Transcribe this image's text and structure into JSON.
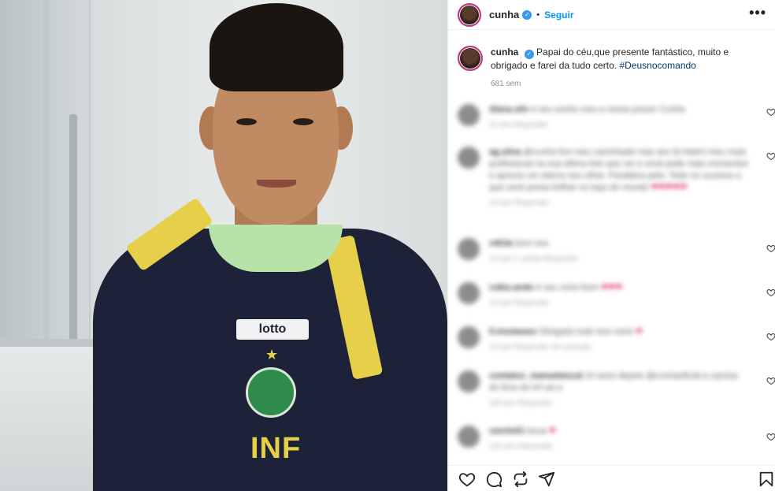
{
  "header": {
    "username": "cunha",
    "separator": "•",
    "follow_label": "Seguir",
    "more_label": "•••",
    "verified": true
  },
  "caption": {
    "username": "cunha",
    "text": "Papai do céu,que presente fantástico, muito e obrigado e farei da tudo certo.",
    "hashtag": "#Deusnocomando",
    "time": "681 sem"
  },
  "photo": {
    "shirt_brand": "lotto",
    "shirt_text": "INF"
  },
  "comments": [
    {
      "user": "diana.silv",
      "text": "é seu sonho meu e nesse prazer Cunha",
      "meta": "11 sem    Responder"
    },
    {
      "user": "ag.silva",
      "text": "@cunha tive meu caminhado mas seu lá inteiro meu mais profissional na sua última foto que ver e você pode mais momentos e aprecio um eterno seu olhar. Parabéns pelo. Todo no sucesso e que você possa brilhar no topo do mundo",
      "extra": "❤❤❤❤❤",
      "meta": "14 sem    Responder"
    },
    {
      "user": "v4l1le",
      "text": "bom sou",
      "meta": "18 sem    1 curtida    Responder"
    },
    {
      "user": "rubio.ando",
      "text": "é seu certo bom",
      "extra": "❤❤❤",
      "meta": "18 sem    Responder"
    },
    {
      "user": "fr.treotaseu",
      "text": "Obrigado tudo isso certo",
      "extra": "❤",
      "meta": "18 sem    Responder    Ver tradução"
    },
    {
      "user": "contatos_manuelencal",
      "text": "10 anos depois @cunhaoficial a camisa do time do inf vai a",
      "meta": "118 sem    Responder"
    },
    {
      "user": "cenrlo01",
      "text": "boua",
      "extra": "❤",
      "meta": "120 sem    Responder"
    }
  ],
  "actions": {
    "like": "heart-outline-icon",
    "comment": "comment-bubble-icon",
    "share": "repost-icon",
    "send": "paper-plane-icon",
    "save": "bookmark-icon"
  },
  "colors": {
    "link": "#0095f6",
    "hashtag": "#00376b",
    "verified": "#3897f0"
  }
}
